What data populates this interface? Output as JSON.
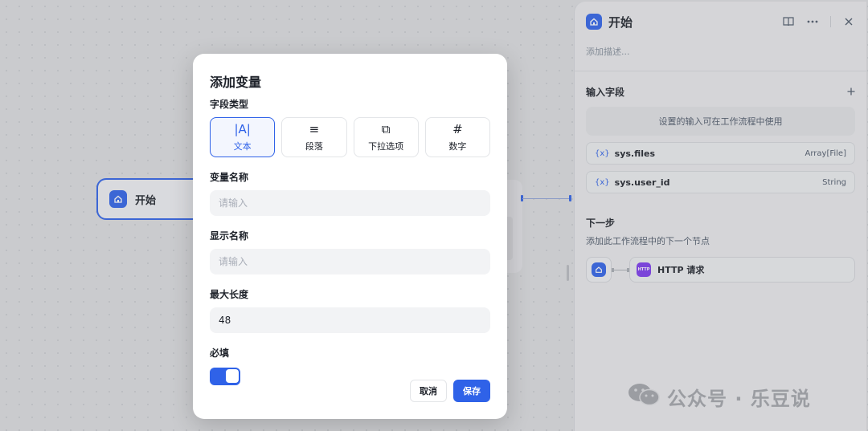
{
  "canvas": {
    "start_node": {
      "title": "开始",
      "icon": "home-icon"
    }
  },
  "panel": {
    "title": "开始",
    "icon": "home-icon",
    "description_placeholder": "添加描述...",
    "input_section": {
      "title": "输入字段",
      "info": "设置的输入可在工作流程中使用",
      "variables": [
        {
          "symbol": "{x}",
          "name": "sys.files",
          "type": "Array[File]"
        },
        {
          "symbol": "{x}",
          "name": "sys.user_id",
          "type": "String"
        }
      ]
    },
    "next_section": {
      "title": "下一步",
      "description": "添加此工作流程中的下一个节点",
      "next_node": {
        "icon_text": "HTTP",
        "label": "HTTP 请求"
      }
    }
  },
  "watermark": {
    "text": "公众号 · 乐豆说"
  },
  "modal": {
    "title": "添加变量",
    "field_type_label": "字段类型",
    "types": [
      {
        "label": "文本",
        "glyph": "|A|",
        "active": true
      },
      {
        "label": "段落",
        "glyph": "≡",
        "active": false
      },
      {
        "label": "下拉选项",
        "glyph": "⧉",
        "active": false
      },
      {
        "label": "数字",
        "glyph": "#",
        "active": false
      }
    ],
    "var_name": {
      "label": "变量名称",
      "placeholder": "请输入",
      "value": ""
    },
    "display_name": {
      "label": "显示名称",
      "placeholder": "请输入",
      "value": ""
    },
    "max_length": {
      "label": "最大长度",
      "value": "48"
    },
    "required": {
      "label": "必填",
      "on": true
    },
    "cancel_label": "取消",
    "save_label": "保存"
  },
  "colors": {
    "accent": "#2f62e8",
    "http_icon": "#7c3aed"
  }
}
